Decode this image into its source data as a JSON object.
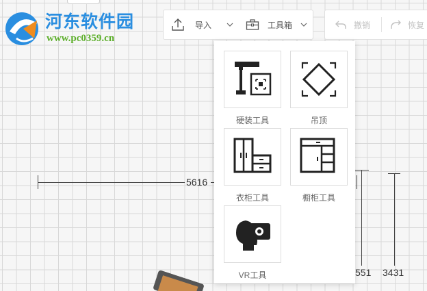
{
  "watermark": {
    "title": "河东软件园",
    "url": "www.pc0359.cn"
  },
  "toolbar": {
    "import_label": "导入",
    "toolbox_label": "工具箱",
    "undo_label": "撤销",
    "redo_label": "恢复"
  },
  "toolbox_menu": {
    "items": [
      {
        "label": "硬装工具",
        "icon": "hardware-tool-icon"
      },
      {
        "label": "吊顶",
        "icon": "ceiling-icon"
      },
      {
        "label": "衣柜工具",
        "icon": "wardrobe-icon"
      },
      {
        "label": "橱柜工具",
        "icon": "cabinet-icon"
      },
      {
        "label": "VR工具",
        "icon": "vr-headset-icon"
      }
    ]
  },
  "canvas": {
    "dimension_horizontal": "5616",
    "dimension_vertical_1": "551",
    "dimension_vertical_2": "3431"
  },
  "colors": {
    "grid_line": "#d8d8d8",
    "background": "#f6f6f6",
    "watermark_blue": "#2a8ee0",
    "watermark_green": "#5cae2a",
    "icon_dark": "#222222",
    "disabled_text": "#c2c2c2"
  }
}
